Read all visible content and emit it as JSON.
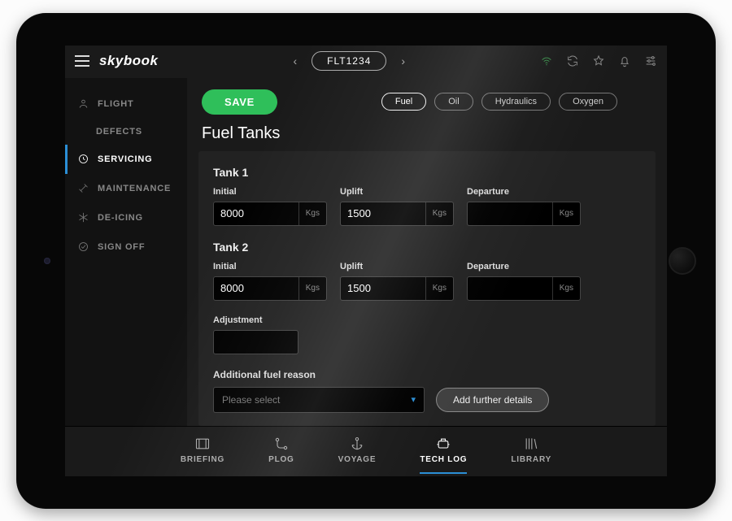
{
  "brand": "skybook",
  "flight_id": "FLT1234",
  "top_icons": [
    "wifi-icon",
    "refresh-icon",
    "star-icon",
    "bell-icon",
    "settings-icon"
  ],
  "save_label": "SAVE",
  "section_title": "Fuel Tanks",
  "chips": [
    {
      "label": "Fuel",
      "active": true
    },
    {
      "label": "Oil",
      "active": false
    },
    {
      "label": "Hydraulics",
      "active": false
    },
    {
      "label": "Oxygen",
      "active": false
    }
  ],
  "sidebar": [
    {
      "label": "FLIGHT",
      "icon": "pilot-icon",
      "active": false,
      "indent": false
    },
    {
      "label": "DEFECTS",
      "icon": "",
      "active": false,
      "indent": true
    },
    {
      "label": "SERVICING",
      "icon": "clock-icon",
      "active": true,
      "indent": false
    },
    {
      "label": "MAINTENANCE",
      "icon": "tools-icon",
      "active": false,
      "indent": false
    },
    {
      "label": "DE-ICING",
      "icon": "snow-icon",
      "active": false,
      "indent": false
    },
    {
      "label": "SIGN OFF",
      "icon": "check-circle-icon",
      "active": false,
      "indent": false
    }
  ],
  "tanks": [
    {
      "name": "Tank 1",
      "fields": [
        {
          "label": "Initial",
          "value": "8000",
          "unit": "Kgs"
        },
        {
          "label": "Uplift",
          "value": "1500",
          "unit": "Kgs"
        },
        {
          "label": "Departure",
          "value": "",
          "unit": "Kgs"
        }
      ]
    },
    {
      "name": "Tank 2",
      "fields": [
        {
          "label": "Initial",
          "value": "8000",
          "unit": "Kgs"
        },
        {
          "label": "Uplift",
          "value": "1500",
          "unit": "Kgs"
        },
        {
          "label": "Departure",
          "value": "",
          "unit": "Kgs"
        }
      ]
    }
  ],
  "adjustment": {
    "label": "Adjustment",
    "value": ""
  },
  "reason": {
    "label": "Additional fuel reason",
    "placeholder": "Please select",
    "button": "Add further details"
  },
  "bottom_tabs": [
    {
      "label": "BRIEFING",
      "icon": "map-icon",
      "active": false
    },
    {
      "label": "PLOG",
      "icon": "route-icon",
      "active": false
    },
    {
      "label": "VOYAGE",
      "icon": "anchor-icon",
      "active": false
    },
    {
      "label": "TECH LOG",
      "icon": "engine-icon",
      "active": true
    },
    {
      "label": "LIBRARY",
      "icon": "books-icon",
      "active": false
    }
  ]
}
